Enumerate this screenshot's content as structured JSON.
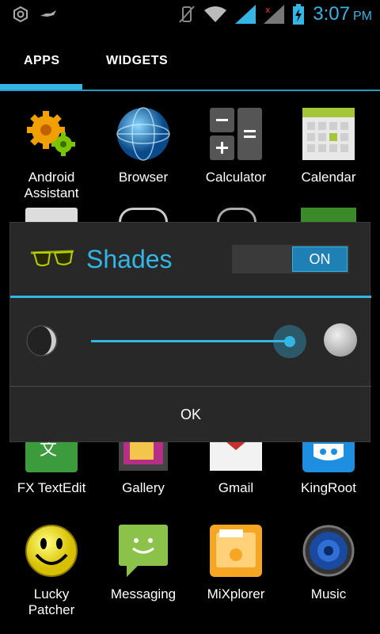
{
  "status": {
    "time": "3:07",
    "ampm": "PM"
  },
  "tabs": [
    {
      "label": "APPS"
    },
    {
      "label": "WIDGETS"
    }
  ],
  "apps": [
    {
      "label": "Android Assistant",
      "icon": "gear-icon"
    },
    {
      "label": "Browser",
      "icon": "globe-icon"
    },
    {
      "label": "Calculator",
      "icon": "calculator-icon"
    },
    {
      "label": "Calendar",
      "icon": "calendar-icon"
    },
    {
      "label": "FX TextEdit",
      "icon": "fx-textedit-icon"
    },
    {
      "label": "Gallery",
      "icon": "gallery-icon"
    },
    {
      "label": "Gmail",
      "icon": "gmail-icon"
    },
    {
      "label": "KingRoot",
      "icon": "kingroot-icon"
    },
    {
      "label": "Lucky Patcher",
      "icon": "smiley-icon"
    },
    {
      "label": "Messaging",
      "icon": "messaging-icon"
    },
    {
      "label": "MiXplorer",
      "icon": "folder-icon"
    },
    {
      "label": "Music",
      "icon": "speaker-icon"
    }
  ],
  "dialog": {
    "title": "Shades",
    "toggle_label": "ON",
    "ok_label": "OK",
    "brightness_level": 0.95
  },
  "colors": {
    "accent": "#33b5e5",
    "dialog_bg": "#282828"
  }
}
